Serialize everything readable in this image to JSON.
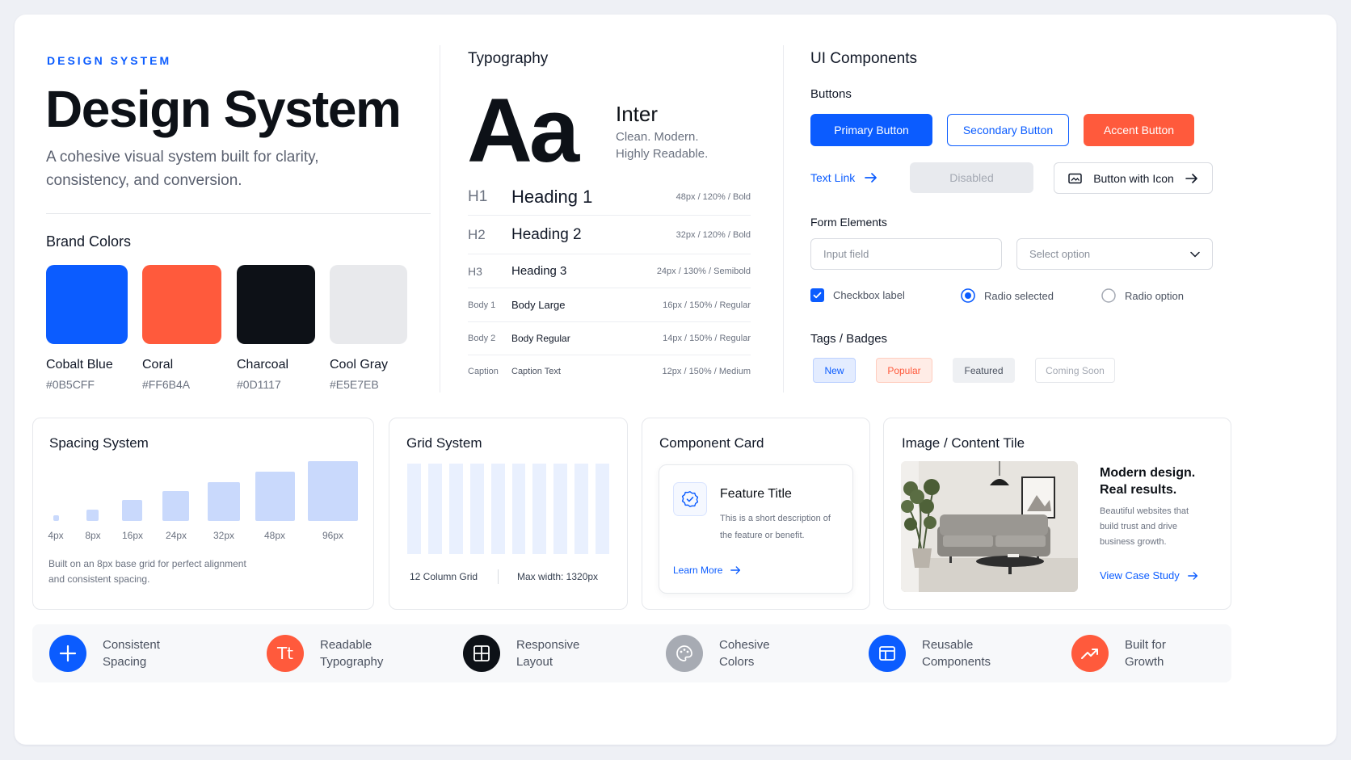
{
  "brand": {
    "eyebrow": "DESIGN SYSTEM",
    "title": "Design System",
    "subtitle": "A cohesive visual system built for clarity, consistency, and conversion.",
    "colors_title": "Brand Colors",
    "colors": [
      {
        "name": "Cobalt Blue",
        "hex": "#0B5CFF"
      },
      {
        "name": "Coral",
        "hex": "#FF6B4A"
      },
      {
        "name": "Charcoal",
        "hex": "#0D1117"
      },
      {
        "name": "Cool Gray",
        "hex": "#E5E7EB"
      }
    ]
  },
  "typography": {
    "title": "Typography",
    "sample": "Aa",
    "font_name": "Inter",
    "font_desc": "Clean. Modern.\nHighly Readable.",
    "rows": [
      {
        "level": "H1",
        "name": "Heading 1",
        "spec": "48px / 120% / Bold"
      },
      {
        "level": "H2",
        "name": "Heading 2",
        "spec": "32px / 120% / Bold"
      },
      {
        "level": "H3",
        "name": "Heading 3",
        "spec": "24px / 130% / Semibold"
      },
      {
        "level": "Body 1",
        "name": "Body Large",
        "spec": "16px / 150% / Regular"
      },
      {
        "level": "Body 2",
        "name": "Body Regular",
        "spec": "14px / 150% / Regular"
      },
      {
        "level": "Caption",
        "name": "Caption Text",
        "spec": "12px / 150% / Medium"
      }
    ]
  },
  "components": {
    "title": "UI Components",
    "buttons_title": "Buttons",
    "primary": "Primary Button",
    "secondary": "Secondary Button",
    "accent": "Accent Button",
    "text_link": "Text Link",
    "disabled": "Disabled",
    "with_icon": "Button with Icon",
    "form_title": "Form Elements",
    "input_placeholder": "Input field",
    "select_placeholder": "Select option",
    "checkbox_label": "Checkbox label",
    "radio_selected": "Radio selected",
    "radio_option": "Radio option",
    "tags_title": "Tags / Badges",
    "tags": [
      "New",
      "Popular",
      "Featured",
      "Coming Soon"
    ]
  },
  "spacing": {
    "title": "Spacing System",
    "steps": [
      "4px",
      "8px",
      "16px",
      "24px",
      "32px",
      "48px",
      "96px"
    ],
    "note": "Built on an 8px base grid for perfect alignment and consistent spacing."
  },
  "grid": {
    "title": "Grid System",
    "columns_label": "12 Column Grid",
    "max_width": "Max width: 1320px"
  },
  "component_card": {
    "title": "Component Card",
    "feature_title": "Feature Title",
    "feature_desc": "This is a short description of the feature or benefit.",
    "link": "Learn More"
  },
  "content_tile": {
    "title": "Image / Content Tile",
    "heading": "Modern design. Real results.",
    "body": "Beautiful websites that build trust and drive business growth.",
    "link": "View Case Study"
  },
  "features": [
    {
      "label": "Consistent\nSpacing",
      "icon": "plus-icon",
      "color": "#0B5CFF"
    },
    {
      "label": "Readable\nTypography",
      "icon": "text-icon",
      "color": "#FF5A3C"
    },
    {
      "label": "Responsive\nLayout",
      "icon": "grid-icon",
      "color": "#0D1117"
    },
    {
      "label": "Cohesive\nColors",
      "icon": "palette-icon",
      "color": "#A7ABB3"
    },
    {
      "label": "Reusable\nComponents",
      "icon": "components-icon",
      "color": "#0B5CFF"
    },
    {
      "label": "Built for\nGrowth",
      "icon": "growth-icon",
      "color": "#FF5A3C"
    }
  ]
}
